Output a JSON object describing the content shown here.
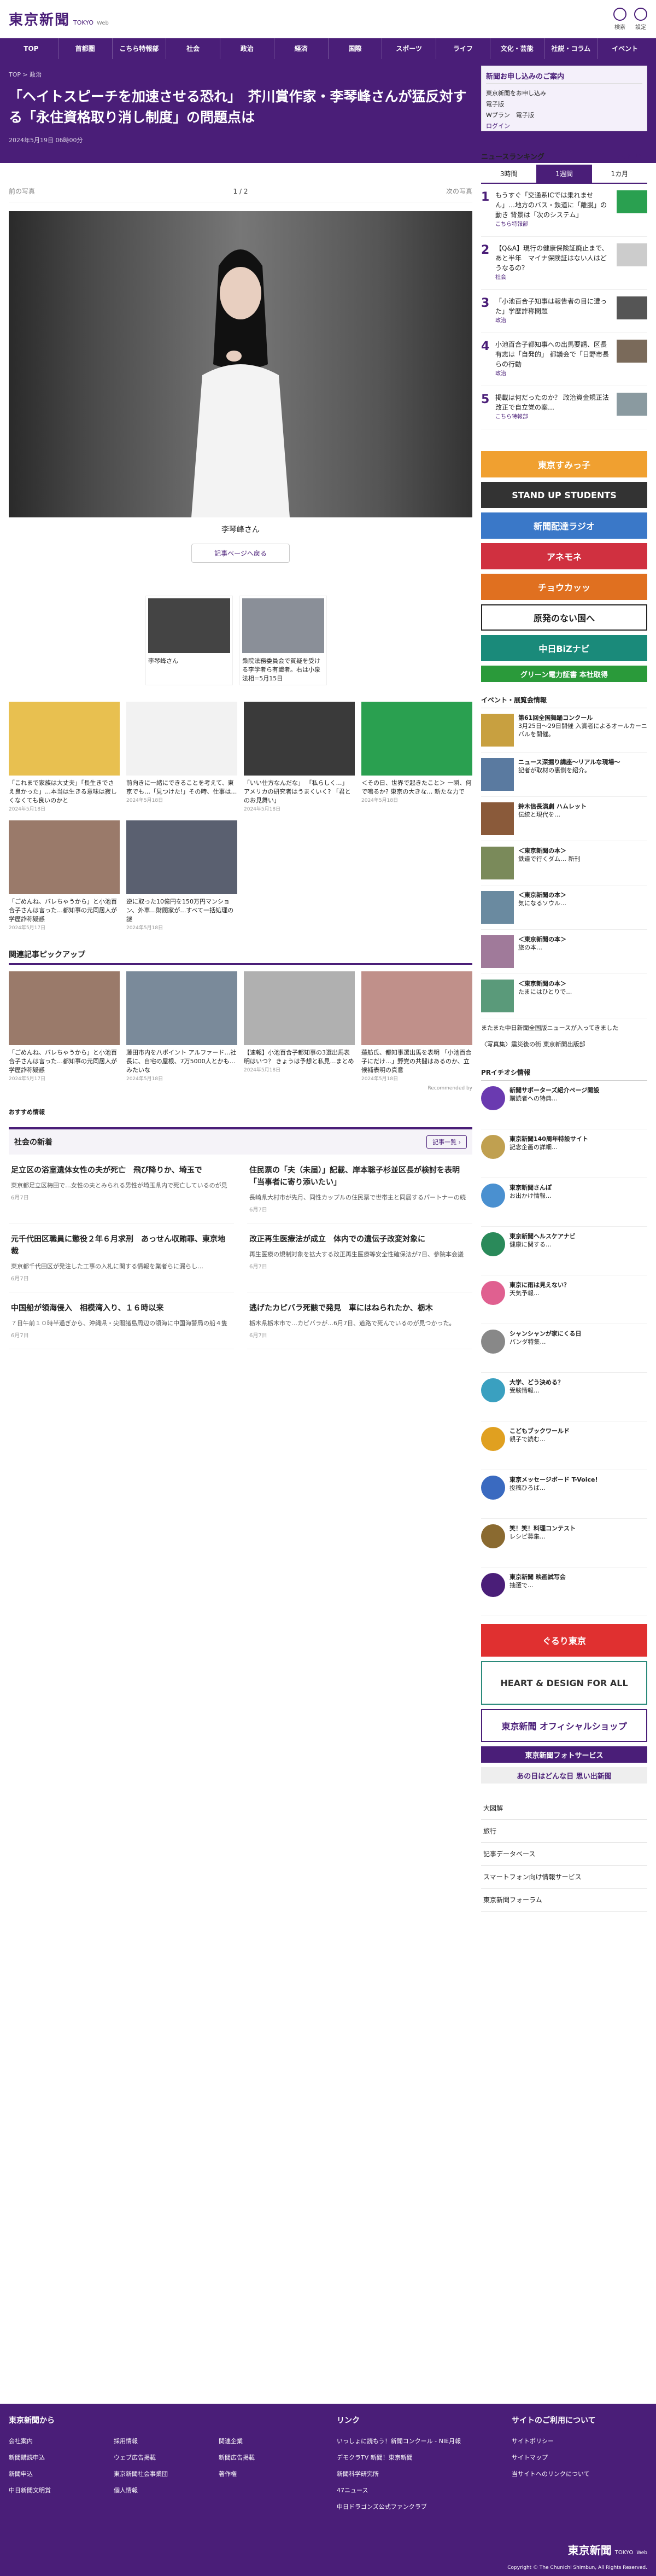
{
  "site": {
    "logo": "東京新聞",
    "logo_en": "TOKYO",
    "logo_web": "Web",
    "icons": [
      "検索",
      "設定"
    ]
  },
  "nav": [
    "TOP",
    "首都圏",
    "こちら特報部",
    "社会",
    "政治",
    "経済",
    "国際",
    "スポーツ",
    "ライフ",
    "文化・芸能",
    "社説・コラム",
    "イベント"
  ],
  "hero": {
    "crumb": "TOP > 政治",
    "headline": "「ヘイトスピーチを加速させる恐れ」　芥川賞作家・李琴峰さんが猛反対する「永住資格取り消し制度」の問題点は",
    "date": "2024年5月19日 06時00分"
  },
  "gallery": {
    "prev": "前の写真",
    "counter": "1 / 2",
    "next": "次の写真",
    "caption": "李琴峰さん",
    "back": "記事ページへ戻る"
  },
  "thumbs": [
    {
      "label": "李琴峰さん"
    },
    {
      "label": "衆院法務委員会で質疑を受ける李学者ら有識者。右は小泉法相=5月15日"
    }
  ],
  "cards1": [
    {
      "text": "「これまで家族は大丈夫」「長生きでさえ良かった」…本当は生きる意味は寂しくなくても良いのかと",
      "date": "2024年5月18日"
    },
    {
      "text": "前向きに一緒にできることを考えて、東京でも…「見つけた!」その時、仕事は…",
      "date": "2024年5月18日"
    },
    {
      "text": "「いい仕方なんだな」 「私らしく…」 アメリカの研究者はうまくいく? 「君とのお見舞い」",
      "date": "2024年5月18日"
    },
    {
      "text": "＜その日、世界で起きたこと＞ 一瞬、何で鳴るか? 東京の大きな… 新たな力で",
      "date": "2024年5月18日"
    }
  ],
  "cards2": [
    {
      "text": "「ごめんね、バレちゃうから」と小池百合子さんは言った…都知事の元同居人が学歴詐称疑惑",
      "date": "2024年5月17日"
    },
    {
      "text": "逆に取った10億円を150万円マンション、外車…財閥家が…すべて一括処理の謎",
      "date": "2024年5月18日"
    }
  ],
  "related": {
    "title": "関連記事ピックアップ",
    "rec": "Recommended by",
    "cards": [
      {
        "text": "「ごめんね、バレちゃうから」と小池百合子さんは言った…都知事の元同居人が学歴詐称疑惑",
        "date": "2024年5月17日"
      },
      {
        "text": "藤田市内を八ポイント アルファード…社長に、自宅の屋根、7万5000人とかも…みたいな",
        "date": "2024年5月18日"
      },
      {
        "text": "【速報】小池百合子都知事の3選出馬表明はいつ？ きょうは予想と私見…まとめ",
        "date": "2024年5月18日"
      },
      {
        "text": "蓮舫氏、都知事選出馬を表明 「小池百合子にだけ…」野党の共闘はあるのか、立候補表明の真意",
        "date": "2024年5月18日"
      }
    ]
  },
  "osusume": "おすすめ情報",
  "social": {
    "title": "社会の新着",
    "more": "記事一覧 ›",
    "items": [
      {
        "t": "足立区の浴室遺体女性の夫が死亡　飛び降りか、埼玉で",
        "d": "東京都足立区梅田で…女性の夫とみられる男性が埼玉県内で死亡しているのが見つかった。",
        "dt": "6月7日"
      },
      {
        "t": "住民票の「夫（未届）」記載、岸本聡子杉並区長が検討を表明　「当事者に寄り添いたい」",
        "d": "長崎県大村市が先月、同性カップルの住民票で世帯主と同居するパートナーの続柄欄に「夫（未届）」と記載…",
        "dt": "6月7日"
      },
      {
        "t": "元千代田区職員に懲役２年６月求刑　あっせん収賄罪、東京地裁",
        "d": "東京都千代田区が発注した工事の入札に関する情報を業者らに漏らし…",
        "dt": "6月7日"
      },
      {
        "t": "改正再生医療法が成立　体内での遺伝子改変対象に",
        "d": "再生医療の規制対象を拡大する改正再生医療等安全性確保法が7日、参院本会議で…",
        "dt": "6月7日"
      },
      {
        "t": "中国船が領海侵入　相模湾入り、１６時以来",
        "d": "７日午前１０時半過ぎから、沖縄県・尖閣諸島周辺の領海に中国海警局の船４隻が相次いで侵入した。",
        "dt": "6月7日"
      },
      {
        "t": "逃げたカピバラ死骸で発見　車にはねられたか、栃木",
        "d": "栃木県栃木市で…カピバラが…6月7日、道路で死んでいるのが見つかった。",
        "dt": "6月7日"
      }
    ]
  },
  "promo": {
    "title": "新聞お申し込みのご案内",
    "lines": [
      "東京新聞をお申し込み",
      "電子版",
      "Wプラン　電子版",
      "ログイン"
    ]
  },
  "ranking": {
    "title": "ニュースランキング",
    "more": "もっと見る ›",
    "tabs": [
      "3時間",
      "1週間",
      "1カ月"
    ],
    "items": [
      {
        "n": "1",
        "t": "もうすぐ「交通系ICでは乗れません」…地方のバス・鉄道に「離脱」の動き 背景は「次のシステム」",
        "c": "こちら特報部"
      },
      {
        "n": "2",
        "t": "【Q&A】現行の健康保険証廃止まで、あと半年　マイナ保険証はない人はどうなるの？",
        "c": "社会"
      },
      {
        "n": "3",
        "t": "「小池百合子知事は報告者の目に遭った」学歴詐称問題",
        "c": "政治"
      },
      {
        "n": "4",
        "t": "小池百合子都知事への出馬要請、区長有志は「自発的」 都議会で「日野市長らの行動",
        "c": "政治"
      },
      {
        "n": "5",
        "t": "掲載は何だったのか？ 政治資金規正法改正で自立党の案…",
        "c": "こちら特報部"
      }
    ]
  },
  "banners": [
    {
      "label": "東京すみっ子",
      "color": "#f0a030"
    },
    {
      "label": "STAND UP STUDENTS",
      "color": "#333"
    },
    {
      "label": "新聞配達ラジオ",
      "color": "#3a78c8"
    },
    {
      "label": "アネモネ",
      "color": "#d03040"
    },
    {
      "label": "チョウカッッ",
      "color": "#e07020"
    },
    {
      "label": "原発のない国へ",
      "color": "#fff"
    },
    {
      "label": "中日BiZナビ",
      "color": "#1a8a7a"
    },
    {
      "label": "グリーン電力証書 本社取得",
      "color": "#2a9a3a"
    }
  ],
  "events": {
    "title": "イベント・展覧会情報",
    "items": [
      {
        "t": "第61回全国舞踊コンクール",
        "d": "3月25日〜29日開催 入賞者によるオールカーニバルを開催。"
      },
      {
        "t": "ニュース深掘り講座〜リアルな現場〜",
        "d": "記者が取材の裏側を紹介。"
      },
      {
        "t": "鈴木信長演劇 ハムレット",
        "d": "伝統と現代を…"
      },
      {
        "t": "＜東京新聞の本＞",
        "d": "鉄道で行くダム… 新刊"
      },
      {
        "t": "＜東京新聞の本＞",
        "d": "気になるソウル…"
      },
      {
        "t": "＜東京新聞の本＞",
        "d": "旅の本…"
      },
      {
        "t": "＜東京新聞の本＞",
        "d": "たまにはひとりで…"
      }
    ],
    "extra": [
      "またまた中日新聞全国版ニュースが入ってきました",
      "〈写真集〉震災後の街 東京新聞出版部"
    ]
  },
  "pr": {
    "title": "PRイチオシ情報",
    "items": [
      {
        "t": "新聞サポーターズ紹介ページ開設",
        "d": "購読者への特典…",
        "color": "#6a3ab0"
      },
      {
        "t": "東京新聞140周年特設サイト",
        "d": "記念企画の詳細…",
        "color": "#c0a050"
      },
      {
        "t": "東京新聞さんぽ",
        "d": "お出かけ情報…",
        "color": "#4a90d0"
      },
      {
        "t": "東京新聞ヘルスケアナビ",
        "d": "健康に関する…",
        "color": "#2a8a5a"
      },
      {
        "t": "東京に雨は見えない？",
        "d": "天気予報…",
        "color": "#e06090"
      },
      {
        "t": "シャンシャンが家にくる日",
        "d": "パンダ特集…",
        "color": "#888"
      },
      {
        "t": "大学、どう決める？",
        "d": "受験情報…",
        "color": "#3aa0c0"
      },
      {
        "t": "こどもブックワールド",
        "d": "親子で読む…",
        "color": "#e0a020"
      },
      {
        "t": "東京メッセージボード T-Voice!",
        "d": "投稿ひろば…",
        "color": "#3a6ac0"
      },
      {
        "t": "笑！笑！料理コンテスト",
        "d": "レシピ募集…",
        "color": "#8a6a30"
      },
      {
        "t": "東京新聞 映画試写会",
        "d": "抽選で…",
        "color": "#4a1e78"
      }
    ]
  },
  "sidebanners": [
    "ぐるり東京",
    "HEART & DESIGN FOR ALL",
    "東京新聞 オフィシャルショップ",
    "東京新聞フォトサービス",
    "あの日はどんな日 思い出新聞"
  ],
  "links": [
    "大図解",
    "旅行",
    "記事データベース",
    "スマートフォン向け情報サービス",
    "東京新聞フォーラム"
  ],
  "footer": {
    "c1": {
      "title": "東京新聞から",
      "items": [
        "会社案内",
        "採用情報",
        "関連企業",
        "新聞購読申込",
        "ウェブ広告掲載",
        "新聞広告掲載",
        "新聞申込",
        "東京新聞社会事業団",
        "著作権",
        "中日新聞文明賞",
        "個人情報"
      ]
    },
    "c2": {
      "title": "リンク",
      "items": [
        "いっしょに読もう！新聞コンクール - NIE月報",
        "デモクラTV 新聞！東京新聞",
        "新聞科学研究所",
        "47ニュース",
        "中日ドラゴンズ公式ファンクラブ"
      ]
    },
    "c3": {
      "title": "サイトのご利用について",
      "items": [
        "サイトポリシー",
        "サイトマップ",
        "当サイトへのリンクについて"
      ]
    },
    "copy": "Copyright © The Chunichi Shimbun, All Rights Reserved."
  }
}
